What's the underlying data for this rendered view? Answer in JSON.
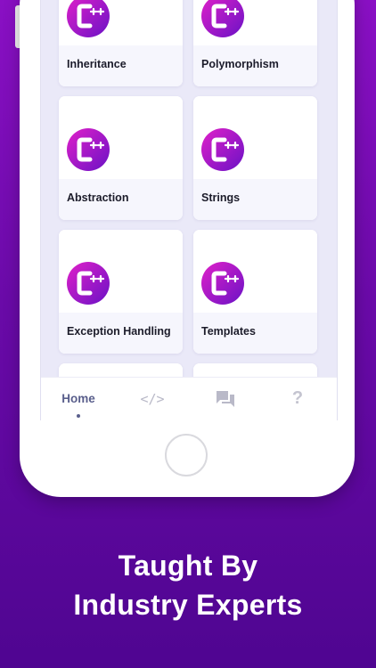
{
  "topics": [
    {
      "label": "Inheritance",
      "icon": "cpp-logo-icon"
    },
    {
      "label": "Polymorphism",
      "icon": "cpp-logo-icon"
    },
    {
      "label": "Abstraction",
      "icon": "cpp-logo-icon"
    },
    {
      "label": "Strings",
      "icon": "cpp-logo-icon"
    },
    {
      "label": "Exception Handling",
      "icon": "cpp-logo-icon"
    },
    {
      "label": "Templates",
      "icon": "cpp-logo-icon"
    }
  ],
  "tabbar": {
    "home_label": "Home",
    "code_icon": "</>",
    "chat_icon": "chat-icon",
    "help_icon": "?"
  },
  "caption": {
    "line1": "Taught By",
    "line2": "Industry Experts"
  },
  "colors": {
    "background_top": "#8a10c4",
    "background_bottom": "#4f0591",
    "logo_gradient_start": "#e020c8",
    "logo_gradient_end": "#6a12c6",
    "active_tab": "#5a5f8c"
  }
}
